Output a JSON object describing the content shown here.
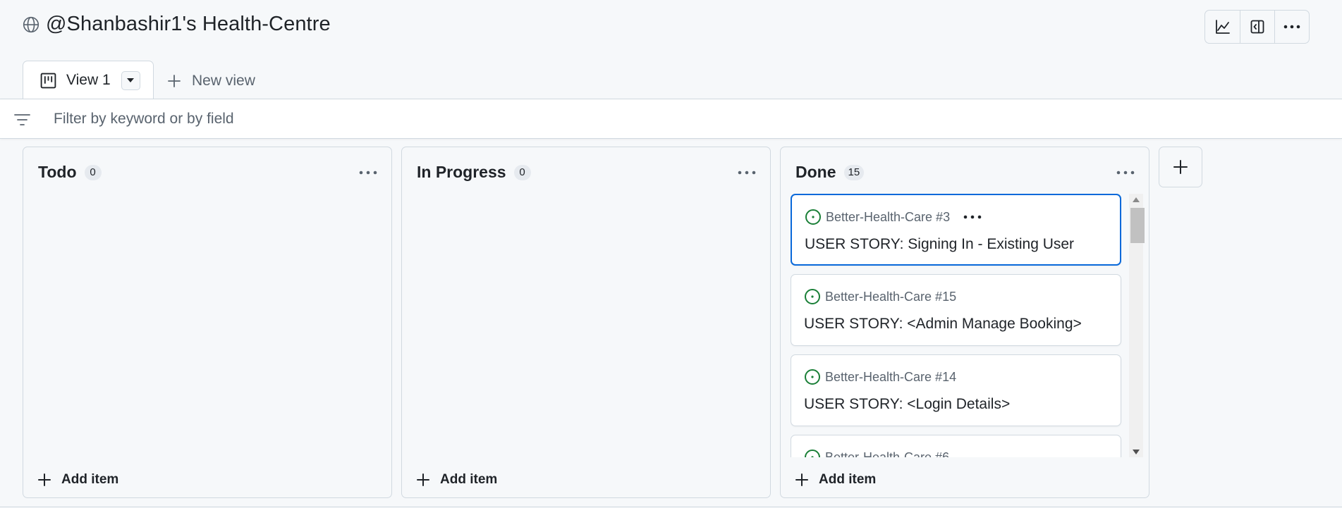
{
  "project": {
    "title": "@Shanbashir1's Health-Centre"
  },
  "top_actions": [
    {
      "icon": "insights-icon"
    },
    {
      "icon": "sidebar-panel-icon"
    },
    {
      "icon": "kebab-menu-icon"
    }
  ],
  "tabs": {
    "active_label": "View 1",
    "new_view_label": "New view"
  },
  "filter": {
    "placeholder": "Filter by keyword or by field",
    "value": ""
  },
  "columns": [
    {
      "title": "Todo",
      "count": "0",
      "add_label": "Add item",
      "cards": []
    },
    {
      "title": "In Progress",
      "count": "0",
      "add_label": "Add item",
      "cards": []
    },
    {
      "title": "Done",
      "count": "15",
      "add_label": "Add item",
      "cards": [
        {
          "ref": "Better-Health-Care #3",
          "title": "USER STORY: Signing In - Existing User",
          "selected": true
        },
        {
          "ref": "Better-Health-Care #15",
          "title": "USER STORY: <Admin Manage Booking>"
        },
        {
          "ref": "Better-Health-Care #14",
          "title": "USER STORY: <Login Details>"
        },
        {
          "ref": "Better-Health-Care #6",
          "title": ""
        }
      ]
    }
  ],
  "colors": {
    "accent": "#0969da",
    "open_issue": "#1a7f37",
    "border": "#d1d9e0",
    "muted_text": "#59636e"
  }
}
